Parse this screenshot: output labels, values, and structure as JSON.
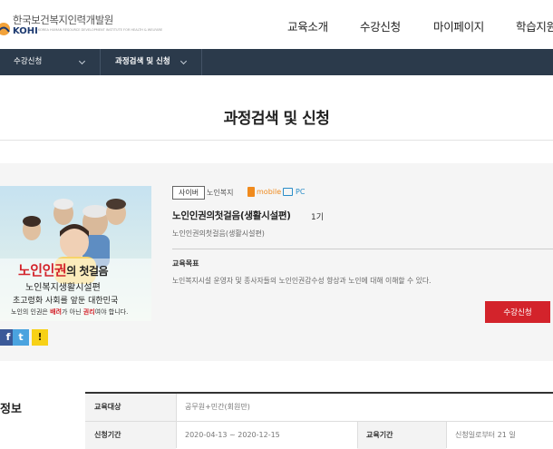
{
  "header": {
    "logo_kr": "한국보건복지인력개발원",
    "logo_en": "KOHI",
    "logo_sub": "KOREA HUMAN RESOURCE DEVELOPMENT INSTITUTE FOR HEALTH & WELFARE",
    "nav": [
      "교육소개",
      "수강신청",
      "마이페이지",
      "학습지원"
    ]
  },
  "subnav": {
    "item1": "수강신청",
    "item2": "과정검색 및 신청"
  },
  "page_title": "과정검색 및 신청",
  "course": {
    "thumbnail": {
      "title_main": "노인인권",
      "title_rest": "의 첫걸음",
      "subtitle": "노인복지생활시설편",
      "line1": "초고령화 사회를 앞둔 대한민국",
      "line2_a": "노인의 인권은 ",
      "line2_b": "배려",
      "line2_c": "가 아닌 ",
      "line2_d": "권리",
      "line2_e": "여야 합니다."
    },
    "tag": "사이버",
    "category": "노인복지",
    "mobile_label": "mobile",
    "pc_label": "PC",
    "title": "노인인권의첫걸음(생활시설편)",
    "generation": "1기",
    "subtitle": "노인인권의첫걸음(생활시설편)",
    "goal_heading": "교육목표",
    "goal_text": "노인복지시설 운영자 및 종사자들의 노인인권감수성 향상과 노인에 대해 이해할 수 있다.",
    "apply_label": "수강신청",
    "share": [
      {
        "icon": "facebook-icon",
        "glyph": "f",
        "color": "#3b5998"
      },
      {
        "icon": "twitter-icon",
        "glyph": "t",
        "color": "#4aa3df"
      },
      {
        "icon": "kakao-icon",
        "glyph": "!",
        "color": "#f7d117"
      }
    ]
  },
  "info": {
    "heading": "정보",
    "rows": [
      {
        "label": "교육대상",
        "value": "공무원+민간(회원만)"
      },
      {
        "label": "신청기간",
        "value": "2020-04-13 ~ 2020-12-15",
        "label2": "교육기간",
        "value2": "신청일로부터 21 일"
      }
    ]
  },
  "colors": {
    "subnav_bg": "#2b3a4b",
    "apply_btn": "#d3232b",
    "logo_blue": "#1d3a70"
  }
}
